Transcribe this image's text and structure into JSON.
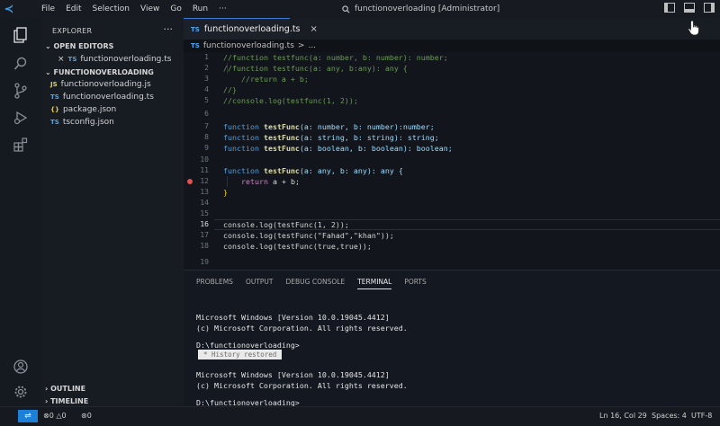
{
  "menu": [
    "File",
    "Edit",
    "Selection",
    "View",
    "Go",
    "Run",
    "···"
  ],
  "command_center": "functionoverloading [Administrator]",
  "sidebar": {
    "title": "EXPLORER",
    "more": "···",
    "open_editors_label": "OPEN EDITORS",
    "open_editors": [
      {
        "icon": "TS",
        "name": "functionoverloading.ts"
      }
    ],
    "project_label": "FUNCTIONOVERLOADING",
    "files": [
      {
        "icon": "JS",
        "name": "functionoverloading.js",
        "color": "#e8d44d"
      },
      {
        "icon": "TS",
        "name": "functionoverloading.ts",
        "color": "#4fa6e8"
      },
      {
        "icon": "{}",
        "name": "package.json",
        "color": "#e8c44d"
      },
      {
        "icon": "TS",
        "name": "tsconfig.json",
        "color": "#4fa6e8"
      }
    ],
    "outline_label": "OUTLINE",
    "timeline_label": "TIMELINE"
  },
  "tab": {
    "icon": "TS",
    "name": "functionoverloading.ts",
    "close": "×"
  },
  "breadcrumb": {
    "icon": "TS",
    "file": "functionoverloading.ts",
    "sep": ">",
    "more": "..."
  },
  "line_numbers": [
    "1",
    "2",
    "3",
    "4",
    "5",
    "6",
    "7",
    "8",
    "9",
    "10",
    "11",
    "12",
    "13",
    "14",
    "15",
    "16",
    "17",
    "18",
    "19"
  ],
  "code": {
    "l1": "//function testfunc(a: number, b: number): number;",
    "l2": "//function testfunc(a: any, b:any): any {",
    "l3": "    //return a + b;",
    "l4": "//}",
    "l5": "//console.log(testfunc(1, 2));",
    "l7": {
      "kw": "function",
      "fn": "testFunc",
      "rest": "(a: number, b: number):number;"
    },
    "l8": {
      "kw": "function",
      "fn": "testFunc",
      "rest": "(a: string, b: string): string;"
    },
    "l9": {
      "kw": "function",
      "fn": "testFunc",
      "rest": "(a: boolean, b: boolean): boolean;"
    },
    "l11": {
      "kw": "function",
      "fn": "testFunc",
      "rest": "(a: any, b: any): any {"
    },
    "l12": {
      "kw": "return",
      "rest": " a + b;"
    },
    "l13": "}",
    "l16": "console.log(testFunc(1, 2));",
    "l17": "console.log(testFunc(\"Fahad\",\"khan\"));",
    "l18": "console.log(testFunc(true,true));"
  },
  "panel": {
    "tabs": [
      "PROBLEMS",
      "OUTPUT",
      "DEBUG CONSOLE",
      "TERMINAL",
      "PORTS"
    ],
    "active_tab": "TERMINAL",
    "lines": [
      "Microsoft Windows [Version 10.0.19045.4412]",
      "(c) Microsoft Corporation. All rights reserved.",
      "D:\\functionoverloading>",
      "Microsoft Windows [Version 10.0.19045.4412]",
      "(c) Microsoft Corporation. All rights reserved.",
      "D:\\functionoverloading>"
    ],
    "history_restored": "* History restored"
  },
  "status": {
    "remote": "⇌",
    "errors": "0",
    "warnings": "0",
    "ports": "0",
    "position": "Ln 16, Col 29",
    "spaces": "Spaces: 4",
    "encoding": "UTF-8"
  },
  "colors": {
    "accent": "#1c7fd8",
    "ts": "#4fa6e8",
    "breakpoint": "#e05252"
  }
}
